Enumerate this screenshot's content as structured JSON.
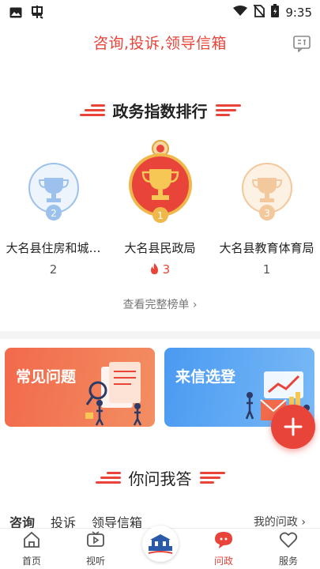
{
  "status_bar": {
    "time": "9:35"
  },
  "header": {
    "title": "咨询,投诉,领导信箱"
  },
  "ranking": {
    "title": "政务指数排行",
    "items": [
      {
        "rank": "2",
        "name": "大名县住房和城…",
        "score": "2",
        "hot": false
      },
      {
        "rank": "1",
        "name": "大名县民政局",
        "score": "3",
        "hot": true
      },
      {
        "rank": "3",
        "name": "大名县教育体育局",
        "score": "1",
        "hot": false
      }
    ],
    "more_label": "查看完整榜单"
  },
  "cards": [
    {
      "label": "常见问题"
    },
    {
      "label": "来信选登"
    }
  ],
  "qa": {
    "title": "你问我答"
  },
  "tabs": [
    {
      "label": "咨询",
      "active": true
    },
    {
      "label": "投诉",
      "active": false
    },
    {
      "label": "领导信箱",
      "active": false
    }
  ],
  "my_link": "我的问政",
  "bottom_nav": [
    {
      "label": "首页",
      "icon": "home-icon"
    },
    {
      "label": "视听",
      "icon": "play-icon"
    },
    {
      "label": "",
      "icon": "center-logo"
    },
    {
      "label": "问政",
      "icon": "chat-bubble-icon",
      "active": true
    },
    {
      "label": "服务",
      "icon": "heart-icon"
    }
  ],
  "colors": {
    "accent": "#e8443a",
    "gold": "#e0a43a",
    "blue": "#4a9af2"
  }
}
